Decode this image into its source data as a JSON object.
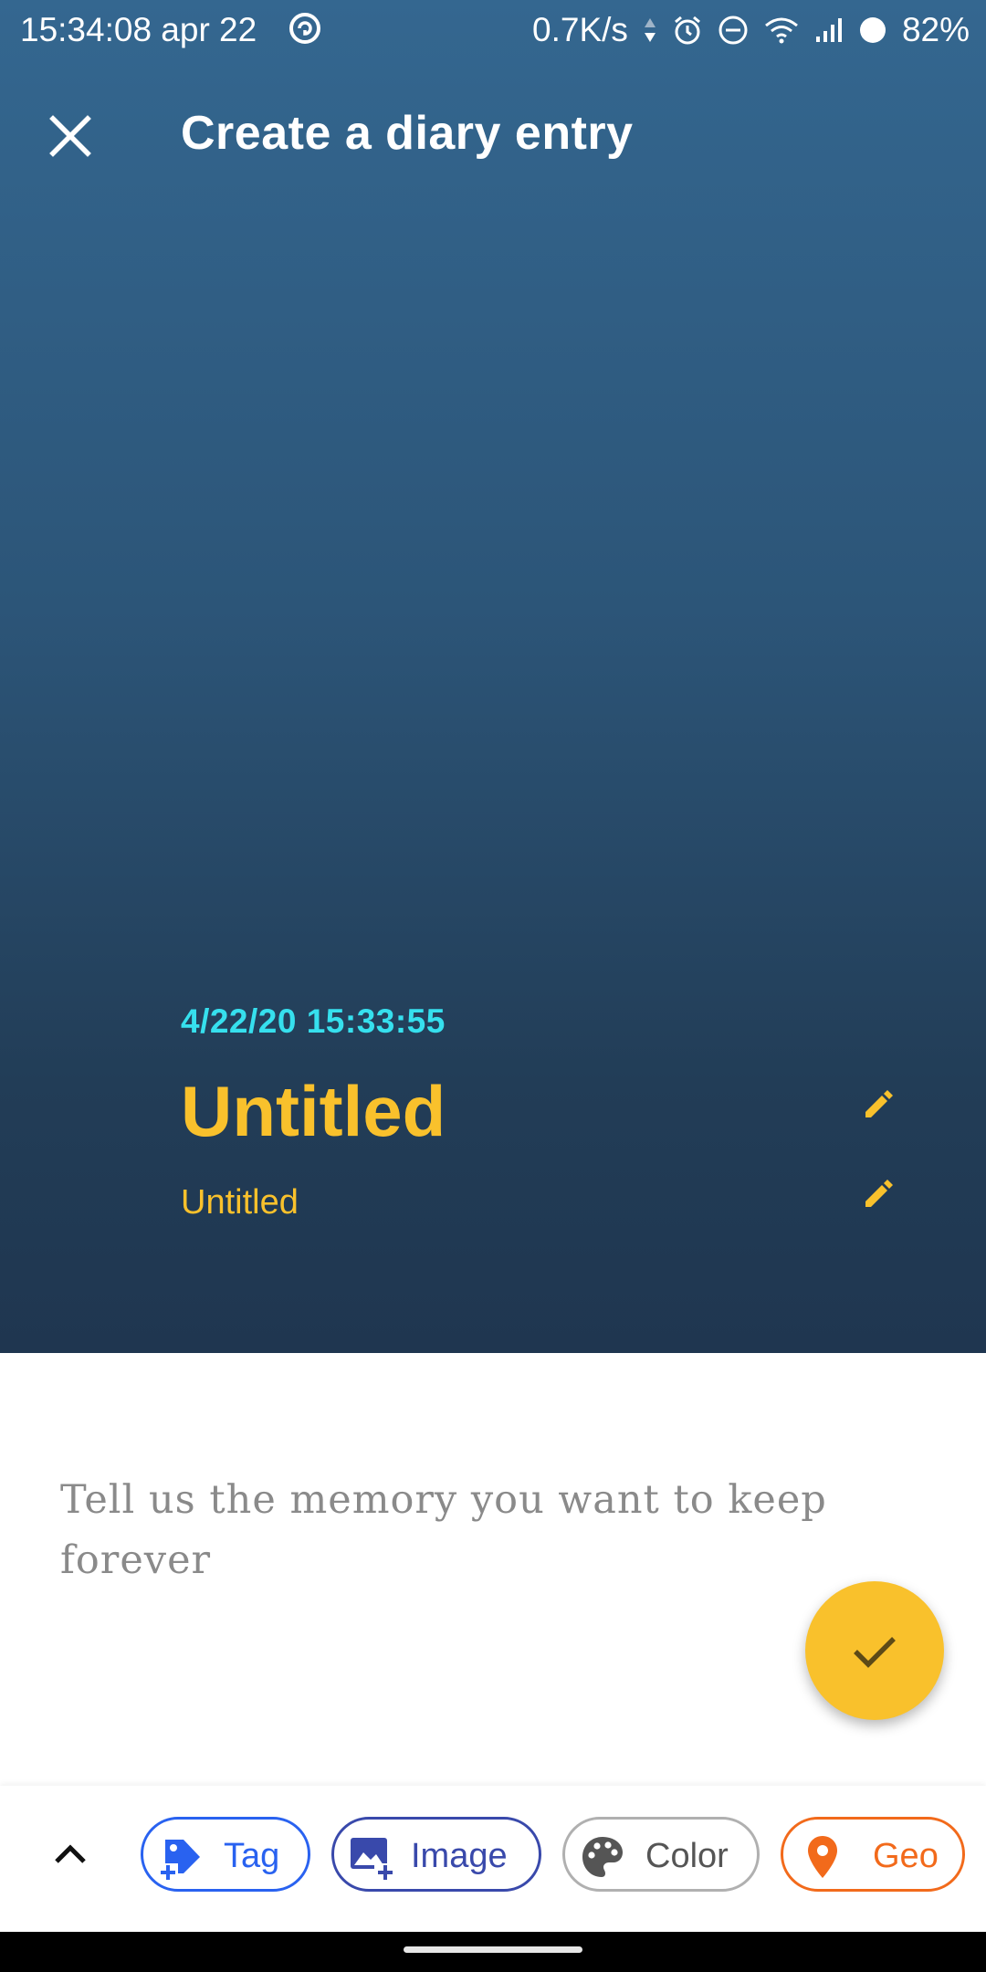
{
  "status_bar": {
    "time": "15:34:08 apr 22",
    "speed": "0.7K/s",
    "battery": "82%"
  },
  "app_bar": {
    "title": "Create a diary entry",
    "close_icon": "close-icon"
  },
  "entry": {
    "datetime": "4/22/20 15:33:55",
    "title": "Untitled",
    "subtitle": "Untitled",
    "body_placeholder": "Tell us the memory you want to keep forever"
  },
  "toolbar": {
    "chips": [
      {
        "label": "Tag",
        "icon": "tag-plus-icon",
        "color": "#2962f0"
      },
      {
        "label": "Image",
        "icon": "image-plus-icon",
        "color": "#3949ab"
      },
      {
        "label": "Color",
        "icon": "palette-icon",
        "color": "#555555"
      },
      {
        "label": "Geo",
        "icon": "map-pin-icon",
        "color": "#f26a1b"
      }
    ]
  },
  "colors": {
    "accent": "#f9c12c",
    "datetime": "#36e0ee",
    "header_top": "#346790",
    "header_bottom": "#1f3650"
  }
}
